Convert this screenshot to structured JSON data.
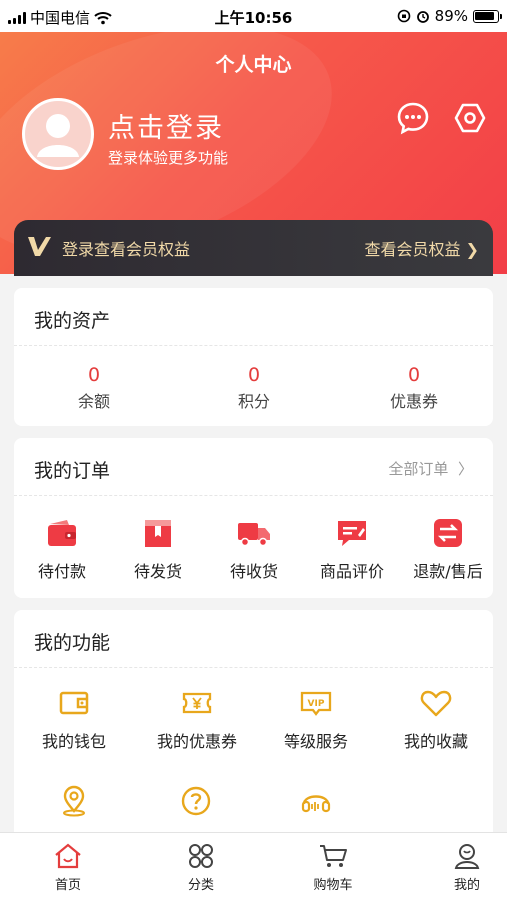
{
  "status_bar": {
    "carrier": "中国电信",
    "time": "上午10:56",
    "battery": "89%"
  },
  "header": {
    "title": "个人中心",
    "login_title": "点击登录",
    "login_subtitle": "登录体验更多功能"
  },
  "vip": {
    "text": "登录查看会员权益",
    "action": "查看会员权益"
  },
  "assets": {
    "title": "我的资产",
    "items": [
      {
        "value": "0",
        "label": "余额"
      },
      {
        "value": "0",
        "label": "积分"
      },
      {
        "value": "0",
        "label": "优惠券"
      }
    ]
  },
  "orders": {
    "title": "我的订单",
    "more": "全部订单",
    "items": [
      {
        "label": "待付款",
        "icon": "wallet-icon"
      },
      {
        "label": "待发货",
        "icon": "package-icon"
      },
      {
        "label": "待收货",
        "icon": "truck-icon"
      },
      {
        "label": "商品评价",
        "icon": "comment-icon"
      },
      {
        "label": "退款/售后",
        "icon": "refund-icon"
      }
    ]
  },
  "functions": {
    "title": "我的功能",
    "items": [
      {
        "label": "我的钱包",
        "icon": "wallet-outline-icon"
      },
      {
        "label": "我的优惠券",
        "icon": "coupon-icon"
      },
      {
        "label": "等级服务",
        "icon": "vip-badge-icon"
      },
      {
        "label": "我的收藏",
        "icon": "heart-icon"
      },
      {
        "label": "",
        "icon": "location-icon"
      },
      {
        "label": "",
        "icon": "help-icon"
      },
      {
        "label": "",
        "icon": "headset-icon"
      }
    ]
  },
  "tabbar": {
    "items": [
      {
        "label": "首页",
        "icon": "home-icon",
        "active": true
      },
      {
        "label": "分类",
        "icon": "grid-icon",
        "active": false
      },
      {
        "label": "购物车",
        "icon": "cart-icon",
        "active": false
      },
      {
        "label": "我的",
        "icon": "profile-icon",
        "active": false
      }
    ]
  },
  "colors": {
    "primary": "#f04347",
    "gold": "#e8a71c",
    "vip_text": "#f1d9a8"
  }
}
